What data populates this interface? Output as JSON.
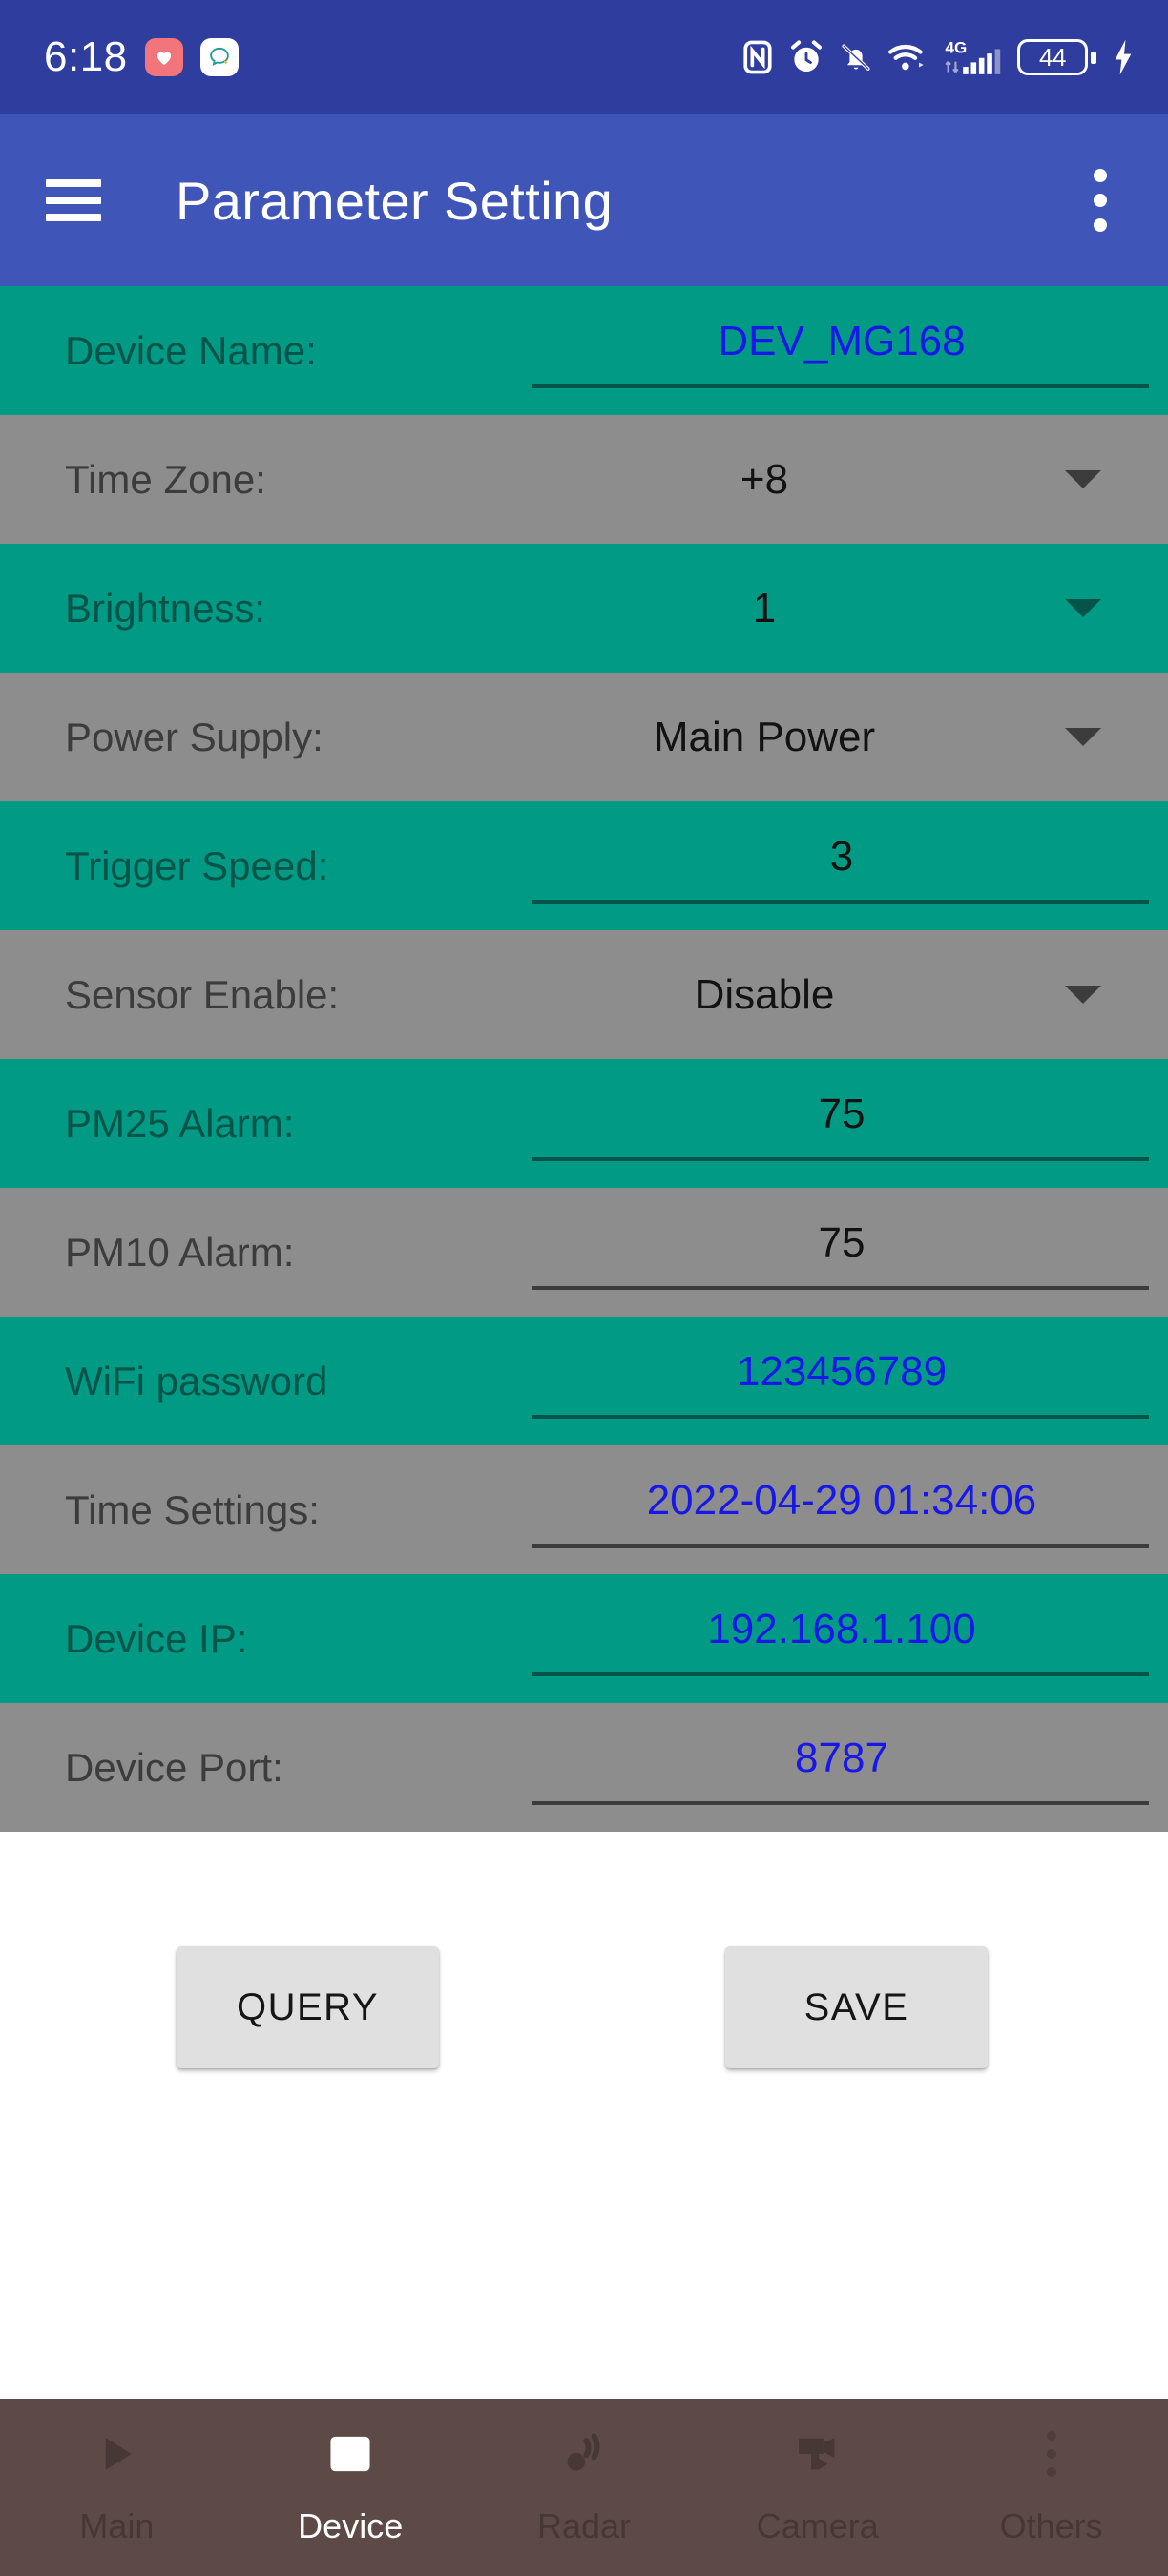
{
  "status_bar": {
    "clock": "6:18",
    "notification_icons": [
      "heart-app-icon",
      "chat-app-icon"
    ],
    "system_icons": [
      "nfc-icon",
      "alarm-icon",
      "bell-muted-icon",
      "wifi-icon",
      "signal-4g-icon"
    ],
    "network_label": "4G",
    "battery_level": "44",
    "charging": true,
    "background_color": "#2f3d9e"
  },
  "app_bar": {
    "title": "Parameter Setting",
    "menu_icon": "hamburger-menu-icon",
    "overflow_icon": "overflow-menu-icon",
    "background_color": "#4055b8"
  },
  "colors": {
    "row_teal": "#009a85",
    "row_gray": "#8d8d8d",
    "value_blue": "#1717e8",
    "nav_background": "#5d4a46"
  },
  "form": {
    "rows": [
      {
        "label": "Device Name:",
        "value": "DEV_MG168",
        "type": "text",
        "tint": "teal",
        "value_color": "blue"
      },
      {
        "label": "Time Zone:",
        "value": "+8",
        "type": "select",
        "tint": "gray",
        "value_color": "black"
      },
      {
        "label": "Brightness:",
        "value": "1",
        "type": "select",
        "tint": "teal",
        "value_color": "black"
      },
      {
        "label": "Power Supply:",
        "value": "Main Power",
        "type": "select",
        "tint": "gray",
        "value_color": "black"
      },
      {
        "label": "Trigger Speed:",
        "value": "3",
        "type": "text",
        "tint": "teal",
        "value_color": "black"
      },
      {
        "label": "Sensor Enable:",
        "value": "Disable",
        "type": "select",
        "tint": "gray",
        "value_color": "black"
      },
      {
        "label": "PM25 Alarm:",
        "value": "75",
        "type": "text",
        "tint": "teal",
        "value_color": "black"
      },
      {
        "label": "PM10 Alarm:",
        "value": "75",
        "type": "text",
        "tint": "gray",
        "value_color": "black"
      },
      {
        "label": "WiFi password",
        "value": "123456789",
        "type": "text",
        "tint": "teal",
        "value_color": "blue"
      },
      {
        "label": "Time Settings:",
        "value": "2022-04-29 01:34:06",
        "type": "text",
        "tint": "gray",
        "value_color": "blue"
      },
      {
        "label": "Device IP:",
        "value": "192.168.1.100",
        "type": "text",
        "tint": "teal",
        "value_color": "blue"
      },
      {
        "label": "Device Port:",
        "value": "8787",
        "type": "text",
        "tint": "gray",
        "value_color": "blue"
      }
    ]
  },
  "actions": {
    "query_label": "QUERY",
    "save_label": "SAVE"
  },
  "bottom_nav": {
    "items": [
      {
        "label": "Main",
        "icon": "play-triangle-icon",
        "active": false
      },
      {
        "label": "Device",
        "icon": "device-screen-icon",
        "active": true
      },
      {
        "label": "Radar",
        "icon": "radar-waves-icon",
        "active": false
      },
      {
        "label": "Camera",
        "icon": "camera-icon",
        "active": false
      },
      {
        "label": "Others",
        "icon": "more-dots-icon",
        "active": false
      }
    ]
  }
}
